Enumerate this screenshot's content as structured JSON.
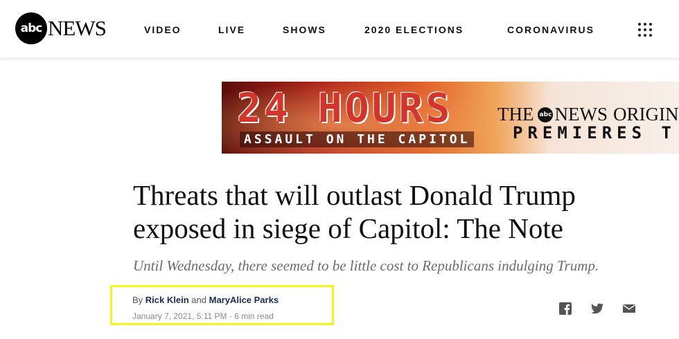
{
  "header": {
    "logo_mark": "abc",
    "logo_text": "NEWS",
    "nav": [
      "VIDEO",
      "LIVE",
      "SHOWS",
      "2020 ELECTIONS",
      "CORONAVIRUS"
    ],
    "menu_icon": "grid-menu-icon"
  },
  "banner": {
    "title": "24 HOURS",
    "subtitle": "ASSAULT ON THE CAPITOL",
    "brand_prefix": "THE",
    "brand_mark": "abc",
    "brand_news": "NEWS",
    "brand_suffix": "ORIGINA",
    "premieres": "PREMIERES T"
  },
  "article": {
    "headline": "Threats that will outlast Donald Trump exposed in siege of Capitol: The Note",
    "subhead": "Until Wednesday, there seemed to be little cost to Republicans indulging Trump.",
    "byline_prefix": "By",
    "author1": "Rick Klein",
    "byline_and": "and",
    "author2": "MaryAlice Parks",
    "date": "January 7, 2021, 5:11 PM",
    "read_time": "6 min read"
  },
  "share_icons": [
    "facebook-icon",
    "twitter-icon",
    "email-icon"
  ],
  "colors": {
    "highlight_box": "#f5f51a",
    "author_link": "#1a2c4e",
    "banner_red": "#d4352a"
  }
}
